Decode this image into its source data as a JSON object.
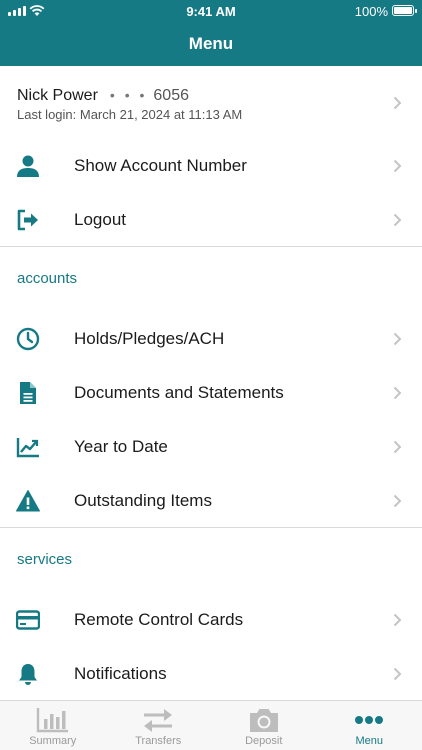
{
  "status_bar": {
    "time": "9:41 AM",
    "battery": "100%"
  },
  "header": {
    "title": "Menu"
  },
  "user": {
    "name": "Nick Power",
    "dots": "• • •",
    "account_suffix": "6056",
    "last_login": "Last login: March 21, 2024 at 11:13 AM"
  },
  "menu": {
    "show_account_number": "Show Account Number",
    "logout": "Logout"
  },
  "accounts": {
    "heading": "accounts",
    "holds": "Holds/Pledges/ACH",
    "documents": "Documents and Statements",
    "ytd": "Year to Date",
    "outstanding": "Outstanding Items"
  },
  "services": {
    "heading": "services",
    "cards": "Remote Control Cards",
    "notifications": "Notifications"
  },
  "tabbar": {
    "summary": "Summary",
    "transfers": "Transfers",
    "deposit": "Deposit",
    "menu": "Menu",
    "active": "Menu"
  },
  "colors": {
    "accent": "#167a85",
    "inactive": "#9a9a9a",
    "icon_gray": "#bdbdbd"
  }
}
